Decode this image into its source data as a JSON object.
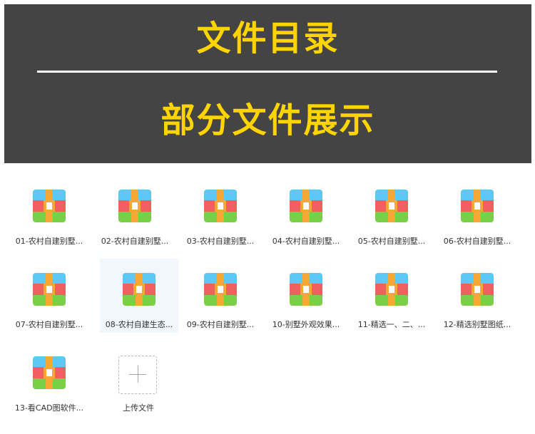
{
  "banner": {
    "title": "文件目录",
    "subtitle": "部分文件展示"
  },
  "files": [
    {
      "name": "01-农村自建别墅..."
    },
    {
      "name": "02-农村自建别墅..."
    },
    {
      "name": "03-农村自建别墅..."
    },
    {
      "name": "04-农村自建别墅..."
    },
    {
      "name": "05-农村自建别墅..."
    },
    {
      "name": "06-农村自建别墅..."
    },
    {
      "name": "07-农村自建别墅..."
    },
    {
      "name": "08-农村自建生态..."
    },
    {
      "name": "09-农村自建别墅..."
    },
    {
      "name": "10-别墅外观效果..."
    },
    {
      "name": "11-精选一、二、..."
    },
    {
      "name": "12-精选别墅图纸..."
    },
    {
      "name": "13-看CAD图软件..."
    }
  ],
  "upload": {
    "label": "上传文件"
  },
  "colors": {
    "banner_bg": "#444444",
    "banner_text": "#ffd400",
    "hover_bg": "#f1f7fd"
  },
  "icons": {
    "file": "archive-icon",
    "upload": "plus-icon"
  }
}
